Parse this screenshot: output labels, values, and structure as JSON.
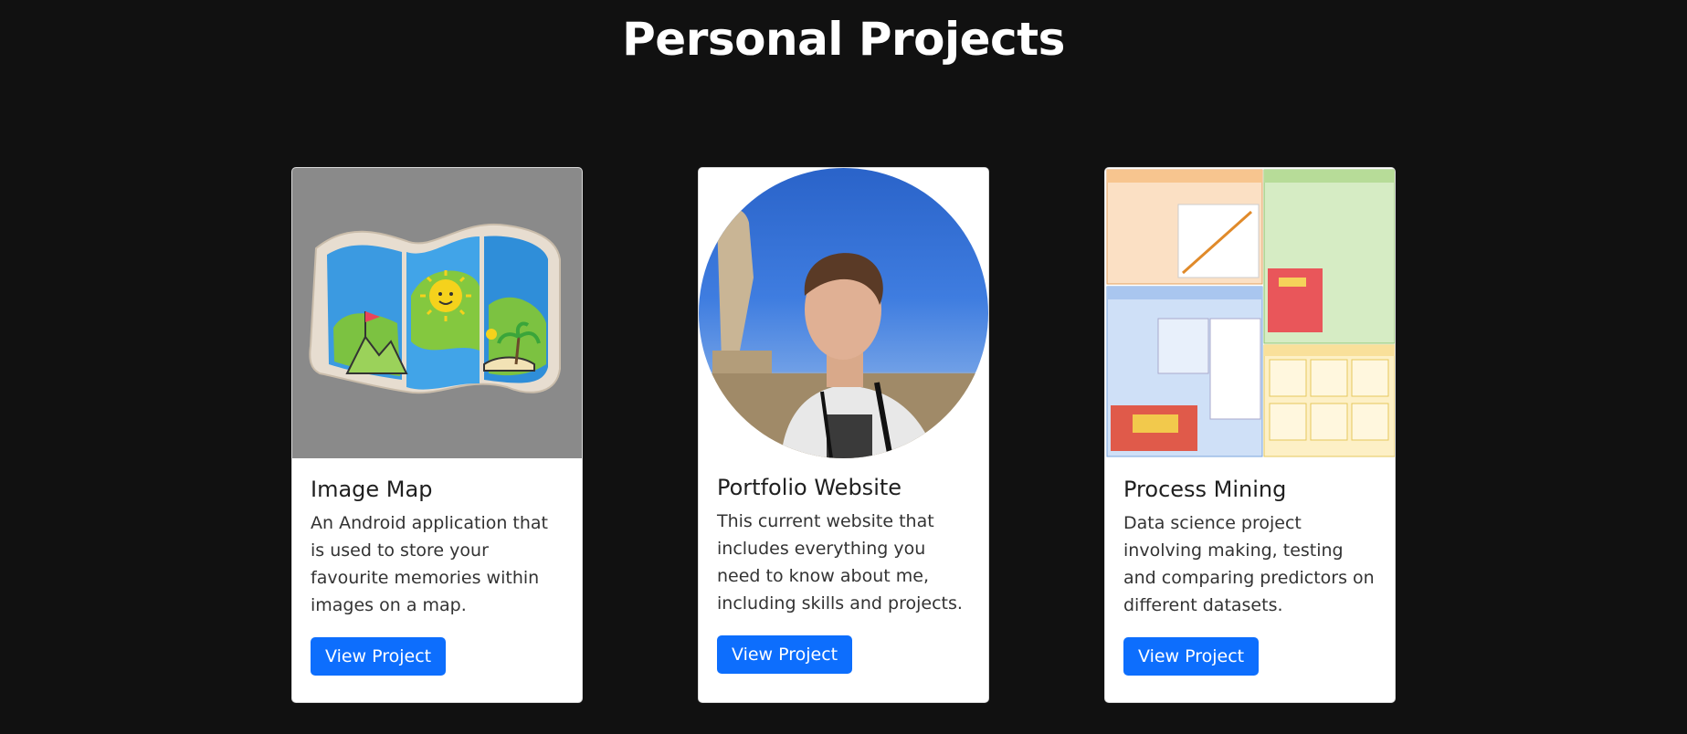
{
  "page": {
    "heading": "Personal Projects"
  },
  "projects": [
    {
      "title": "Image Map",
      "description": "An Android application that is used to store your favourite memories within images on a map.",
      "button_label": "View Project"
    },
    {
      "title": "Portfolio Website",
      "description": "This current website that includes everything you need to know about me, including skills and projects.",
      "button_label": "View Project"
    },
    {
      "title": "Process Mining",
      "description": "Data science project involving making, testing and comparing predictors on different datasets.",
      "button_label": "View Project"
    }
  ],
  "colors": {
    "background": "#111111",
    "card": "#ffffff",
    "button": "#0d6efd",
    "button_text": "#ffffff"
  }
}
